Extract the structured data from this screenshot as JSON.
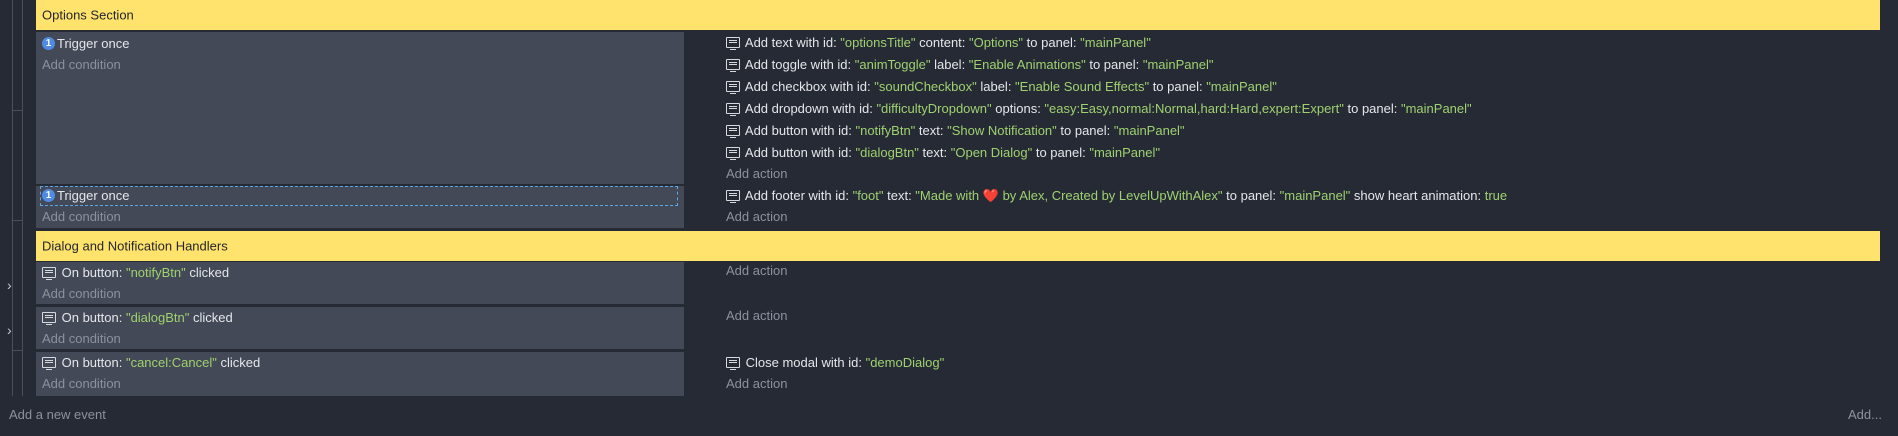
{
  "groups": {
    "options": "Options Section",
    "handlers": "Dialog and Notification Handlers"
  },
  "events": [
    {
      "condition": {
        "label": "Trigger once",
        "add": "Add condition"
      },
      "actions": [
        {
          "parts": [
            "Add text with id: ",
            "\"optionsTitle\"",
            " content: ",
            "\"Options\"",
            " to panel: ",
            "\"mainPanel\""
          ]
        },
        {
          "parts": [
            "Add toggle with id: ",
            "\"animToggle\"",
            " label: ",
            "\"Enable Animations\"",
            " to panel: ",
            "\"mainPanel\""
          ]
        },
        {
          "parts": [
            "Add checkbox with id: ",
            "\"soundCheckbox\"",
            " label: ",
            "\"Enable Sound Effects\"",
            " to panel: ",
            "\"mainPanel\""
          ]
        },
        {
          "parts": [
            "Add dropdown with id: ",
            "\"difficultyDropdown\"",
            " options: ",
            "\"easy:Easy,normal:Normal,hard:Hard,expert:Expert\"",
            " to panel: ",
            "\"mainPanel\""
          ]
        },
        {
          "parts": [
            "Add button with id: ",
            "\"notifyBtn\"",
            " text: ",
            "\"Show Notification\"",
            " to panel: ",
            "\"mainPanel\""
          ]
        },
        {
          "parts": [
            "Add button with id: ",
            "\"dialogBtn\"",
            " text: ",
            "\"Open Dialog\"",
            " to panel: ",
            "\"mainPanel\""
          ]
        }
      ],
      "add_action": "Add action"
    },
    {
      "condition": {
        "label": "Trigger once",
        "add": "Add condition"
      },
      "footer_action": {
        "p1": "Add footer with id: ",
        "p2": "\"foot\"",
        "p3": " text: ",
        "p4": "\"Made with ",
        "heart": "❤️",
        "p5": " by Alex, Created by LevelUpWithAlex\"",
        "p6": " to panel: ",
        "p7": "\"mainPanel\"",
        "p8": " show heart animation: ",
        "p9": "true"
      },
      "add_action": "Add action"
    },
    {
      "condition": {
        "pre": "On button: ",
        "value": "\"notifyBtn\"",
        "post": " clicked",
        "add": "Add condition"
      },
      "add_action": "Add action"
    },
    {
      "condition": {
        "pre": "On button: ",
        "value": "\"dialogBtn\"",
        "post": " clicked",
        "add": "Add condition"
      },
      "add_action": "Add action"
    },
    {
      "condition": {
        "pre": "On button: ",
        "value": "\"cancel:Cancel\"",
        "post": " clicked",
        "add": "Add condition"
      },
      "action": {
        "p1": "Close modal with id: ",
        "p2": "\"demoDialog\""
      },
      "add_action": "Add action"
    }
  ],
  "footer": {
    "add_event": "Add a new event",
    "add_more": "Add..."
  },
  "icons": {
    "once": "1",
    "chevron": "›"
  }
}
